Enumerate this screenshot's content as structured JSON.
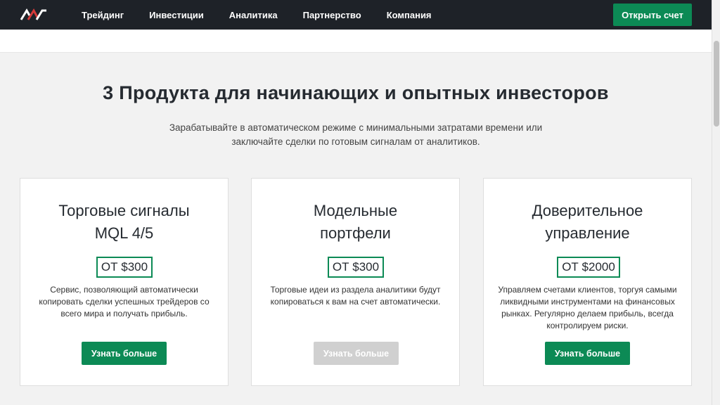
{
  "header": {
    "nav": [
      "Трейдинг",
      "Инвестиции",
      "Аналитика",
      "Партнерство",
      "Компания"
    ],
    "cta_label": "Открыть счет",
    "logo_icon": "brand-logo-icon"
  },
  "section": {
    "title": "3 Продукта для начинающих и опытных инвесторов",
    "subtitle": "Зарабатывайте в автоматическом режиме с минимальными затратами времени или заключайте сделки по готовым сигналам от аналитиков."
  },
  "cards": [
    {
      "title_line1": "Торговые сигналы",
      "title_line2": "MQL 4/5",
      "price": "ОТ $300",
      "description": "Сервис, позволяющий автоматически копировать сделки успешных трейдеров со всего мира и получать прибыль.",
      "button": "Узнать больше",
      "button_state": "active"
    },
    {
      "title_line1": "Модельные",
      "title_line2": "портфели",
      "price": "ОТ $300",
      "description": "Торговые идеи из раздела аналитики будут копироваться к вам на счет автоматически.",
      "button": "Узнать больше",
      "button_state": "disabled"
    },
    {
      "title_line1": "Доверительное",
      "title_line2": "управление",
      "price": "ОТ $2000",
      "description": "Управляем счетами клиентов, торгуя самыми ликвидными инструментами на финансовых рынках. Регулярно делаем прибыль, всегда контролируем риски.",
      "button": "Узнать больше",
      "button_state": "active"
    }
  ],
  "colors": {
    "header_bg": "#1e2228",
    "accent_green": "#0c8a55",
    "disabled_grey": "#d0d0d0"
  }
}
